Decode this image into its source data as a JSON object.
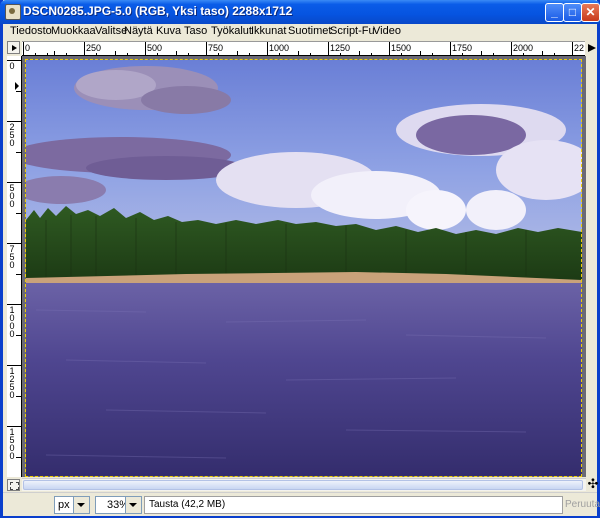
{
  "window": {
    "title": "DSCN0285.JPG-5.0 (RGB, Yksi taso) 2288x1712",
    "min_label": "_",
    "max_label": "□",
    "close_label": "✕"
  },
  "menu": [
    {
      "label": "Tiedosto"
    },
    {
      "label": "Muokkaa"
    },
    {
      "label": "Valitse"
    },
    {
      "label": "Näytä"
    },
    {
      "label": "Kuva"
    },
    {
      "label": "Taso"
    },
    {
      "label": "Työkalut"
    },
    {
      "label": "Ikkunat"
    },
    {
      "label": "Suotimet"
    },
    {
      "label": "Script-Fu"
    },
    {
      "label": "Video"
    }
  ],
  "ruler": {
    "horizontal_ticks": [
      "0",
      "250",
      "500",
      "750",
      "1000",
      "1250",
      "1500",
      "1750",
      "2000",
      "22"
    ],
    "vertical_ticks": [
      "0",
      "250",
      "500",
      "750",
      "1000",
      "1250",
      "1500"
    ]
  },
  "status": {
    "unit": "px",
    "zoom": "33%",
    "layer_info": "Tausta (42,2 MB)",
    "cancel_label": "Peruuta"
  },
  "icons": {
    "app": "gimp-image-icon",
    "menu_arrow": "triangle-right-icon",
    "navigate": "move-cross-icon",
    "quickmask": "quickmask-icon",
    "pointer": "pointer-arrow-icon"
  },
  "colors": {
    "titlebar": "#0654e0",
    "close": "#c8391a",
    "selection_border": "#f0d000"
  }
}
